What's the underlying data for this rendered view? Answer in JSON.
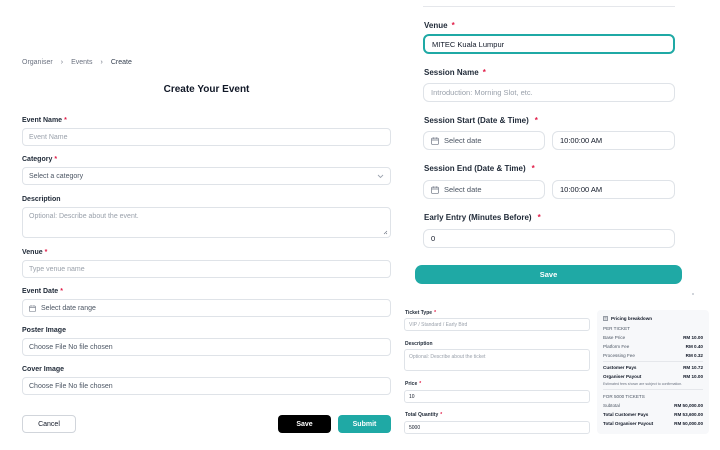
{
  "breadcrumb": {
    "item1": "Organiser",
    "item2": "Events",
    "item3": "Create",
    "sep": "›"
  },
  "create_form": {
    "title": "Create Your Event",
    "event_name": {
      "label": "Event Name",
      "placeholder": "Event Name"
    },
    "category": {
      "label": "Category",
      "placeholder": "Select a category"
    },
    "description": {
      "label": "Description",
      "placeholder": "Optional: Describe about the event."
    },
    "venue": {
      "label": "Venue",
      "placeholder": "Type venue name"
    },
    "event_date": {
      "label": "Event Date",
      "placeholder": "Select date range"
    },
    "poster_image": {
      "label": "Poster Image",
      "value": "Choose File No file chosen"
    },
    "cover_image": {
      "label": "Cover Image",
      "value": "Choose File No file chosen"
    },
    "cancel_label": "Cancel",
    "save_label": "Save",
    "submit_label": "Submit",
    "required_mark": "*"
  },
  "session_form": {
    "venue": {
      "label": "Venue",
      "value": "MITEC Kuala Lumpur"
    },
    "session_name": {
      "label": "Session Name",
      "placeholder": "Introduction: Morning Slot, etc."
    },
    "session_start": {
      "label": "Session Start (Date & Time)",
      "date_placeholder": "Select date",
      "time": "10:00:00 AM"
    },
    "session_end": {
      "label": "Session End (Date & Time)",
      "date_placeholder": "Select date",
      "time": "10:00:00 AM"
    },
    "early_entry": {
      "label": "Early Entry (Minutes Before)",
      "value": "0"
    },
    "save_label": "Save"
  },
  "ticket_form": {
    "ticket_type": {
      "label": "Ticket Type",
      "placeholder": "VIP / Standard / Early Bird"
    },
    "description": {
      "label": "Description",
      "placeholder": "Optional: Describe about the ticket"
    },
    "price": {
      "label": "Price",
      "value": "10"
    },
    "total_quantity": {
      "label": "Total Quantity",
      "value": "5000"
    }
  },
  "pricing": {
    "title": "Pricing breakdown",
    "per_ticket": "PER TICKET",
    "base_price": {
      "label": "Base Price",
      "value": "RM 10.00"
    },
    "platform_fee": {
      "label": "Platform Fee",
      "value": "RM 0.40"
    },
    "processing_fee": {
      "label": "Processing Fee",
      "value": "RM 0.32"
    },
    "customer_pays": {
      "label": "Customer Pays",
      "value": "RM 10.72"
    },
    "organiser_payout": {
      "label": "Organiser Payout",
      "value": "RM 10.00"
    },
    "note": "Estimated fees shown are subject to confirmation.",
    "for_tickets": "FOR 5000 TICKETS",
    "subtotal": {
      "label": "Subtotal",
      "value": "RM 50,000.00"
    },
    "total_customer_pays": {
      "label": "Total Customer Pays",
      "value": "RM 53,600.00"
    },
    "total_organiser_payout": {
      "label": "Total Organiser Payout",
      "value": "RM 50,000.00"
    }
  },
  "colors": {
    "teal": "#1fa9a5",
    "dark": "#000000",
    "required": "#e11d48"
  }
}
